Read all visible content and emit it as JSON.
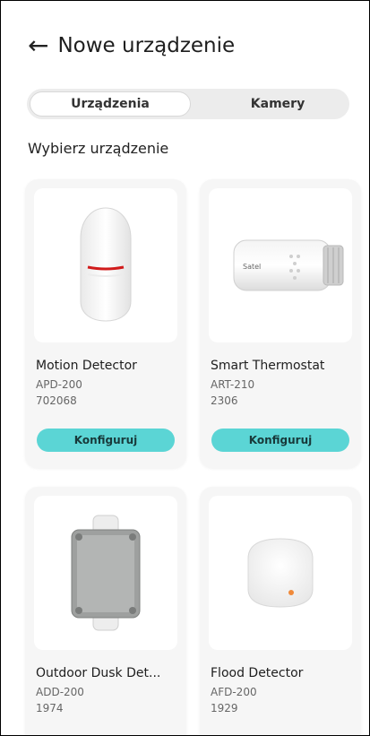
{
  "header": {
    "back_icon": "arrow-left-icon",
    "title": "Nowe urządzenie"
  },
  "tabs": [
    {
      "label": "Urządzenia",
      "active": true
    },
    {
      "label": "Kamery",
      "active": false
    }
  ],
  "section_title": "Wybierz urządzenie",
  "devices": [
    {
      "name": "Motion Detector",
      "model": "APD-200",
      "code": "702068",
      "button": "Konfiguruj",
      "image": "motion-detector"
    },
    {
      "name": "Smart Thermostat",
      "model": "ART-210",
      "code": "2306",
      "button": "Konfiguruj",
      "image": "thermostat-head"
    },
    {
      "name": "Outdoor Dusk Det...",
      "model": "ADD-200",
      "code": "1974",
      "image": "outdoor-dusk-detector"
    },
    {
      "name": "Flood Detector",
      "model": "AFD-200",
      "code": "1929",
      "image": "flood-detector"
    }
  ],
  "colors": {
    "accent": "#5bd5d5",
    "card_bg": "#f6f6f6",
    "segment_bg": "#ececec"
  }
}
